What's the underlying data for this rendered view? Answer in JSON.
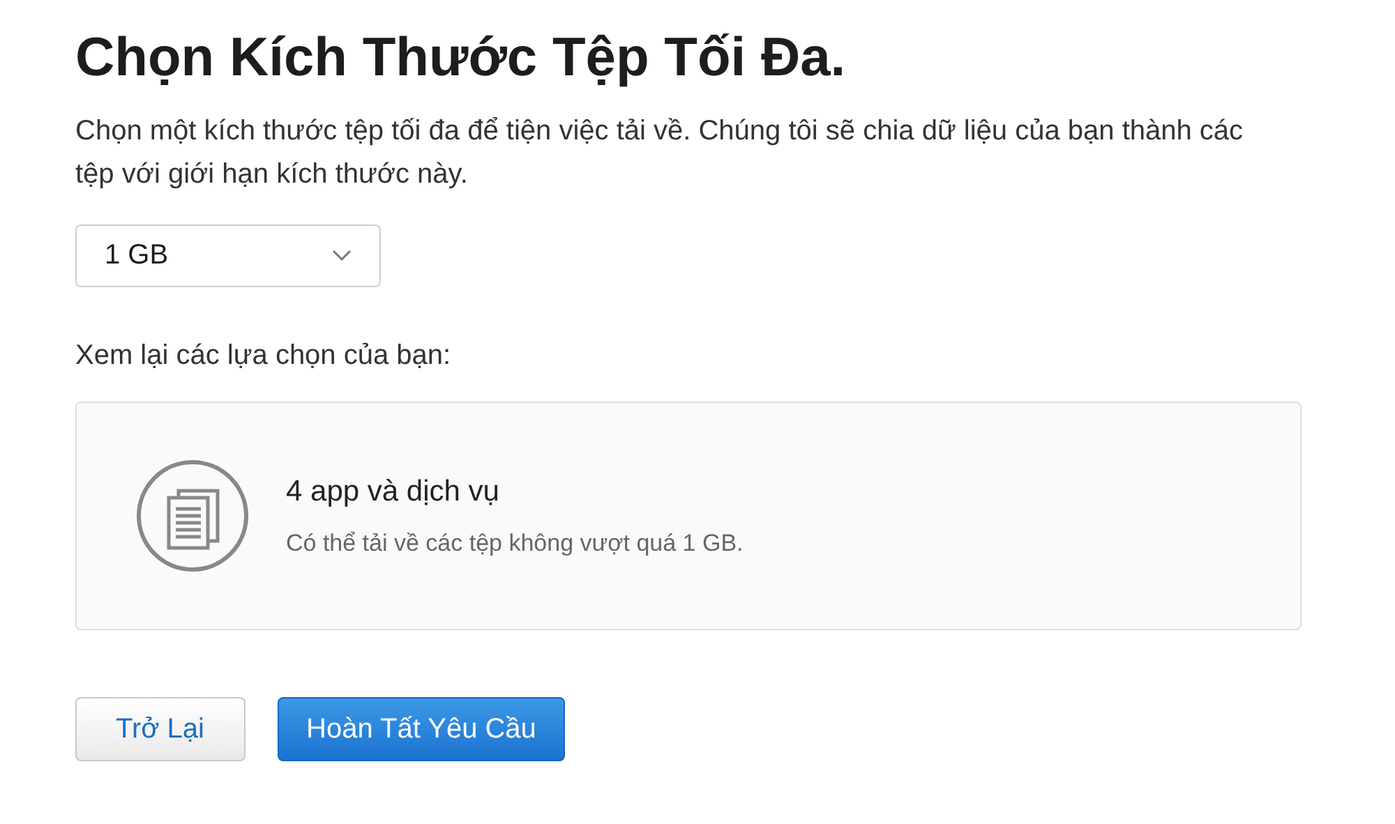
{
  "title": "Chọn Kích Thước Tệp Tối Đa.",
  "description": "Chọn một kích thước tệp tối đa để tiện việc tải về. Chúng tôi sẽ chia dữ liệu của bạn thành các tệp với giới hạn kích thước này.",
  "size_select": {
    "value": "1 GB"
  },
  "review_label": "Xem lại các lựa chọn của bạn:",
  "summary": {
    "title": "4 app và dịch vụ",
    "subtitle": "Có thể tải về các tệp không vượt quá 1 GB."
  },
  "buttons": [
    {
      "label": "Trở Lại",
      "kind": "secondary"
    },
    {
      "label": "Hoàn Tất Yêu Cầu",
      "kind": "primary"
    }
  ]
}
